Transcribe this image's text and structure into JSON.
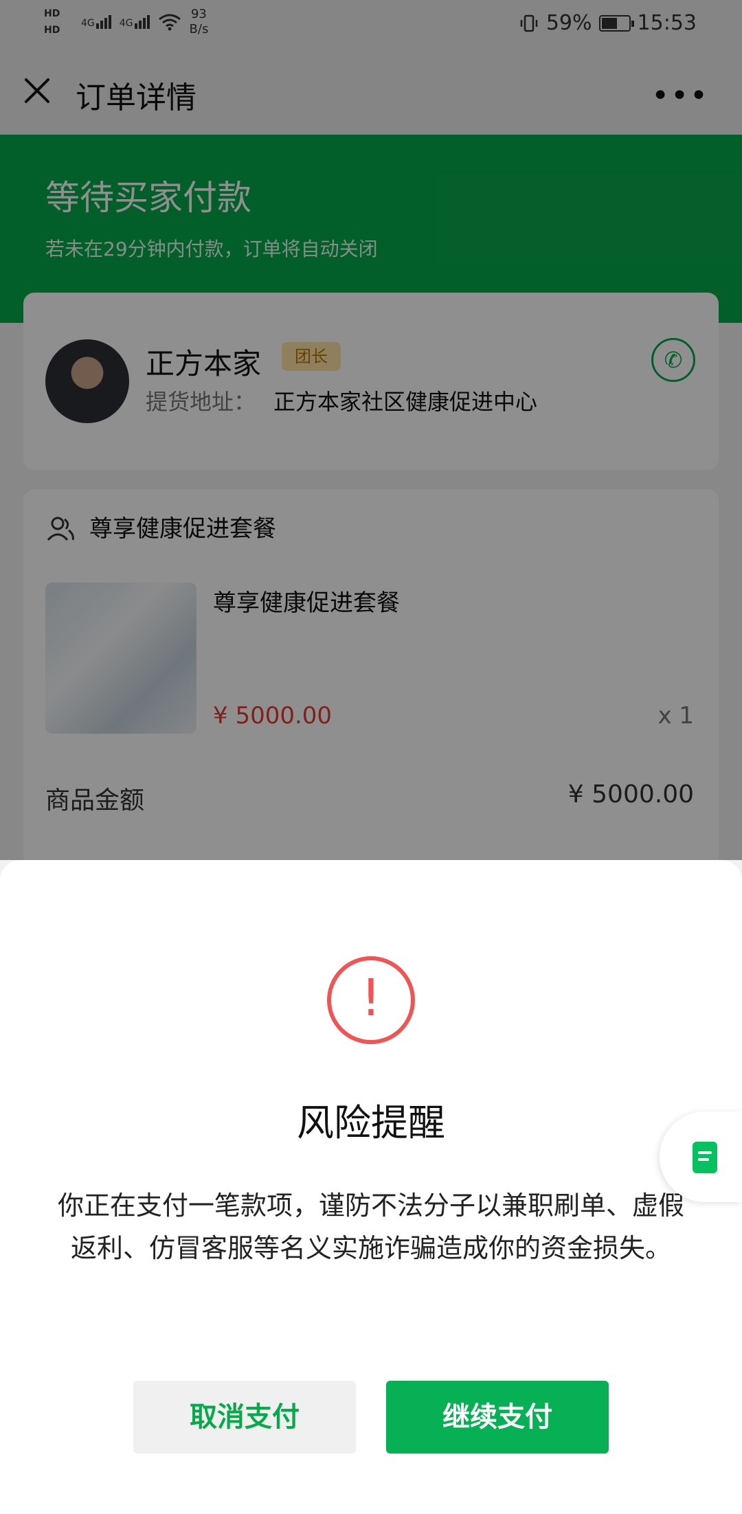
{
  "status_bar": {
    "network": "4G",
    "speed_value": "93",
    "speed_unit": "B/s",
    "battery": "59%",
    "battery_level": 0.59,
    "time": "15:53"
  },
  "header": {
    "title": "订单详情",
    "more": "•••"
  },
  "order": {
    "status_title": "等待买家付款",
    "status_sub": "若未在29分钟内付款，订单将自动关闭",
    "seller": {
      "name": "正方本家",
      "badge": "团长",
      "address_label": "提货地址：",
      "address_value": "正方本家社区健康促进中心"
    },
    "package": {
      "header": "尊享健康促进套餐",
      "product_name": "尊享健康促进套餐",
      "price": "¥ 5000.00",
      "quantity": "x 1",
      "amount_label": "商品金额",
      "amount_value": "¥ 5000.00"
    }
  },
  "risk_dialog": {
    "title": "风险提醒",
    "message": "你正在支付一笔款项，谨防不法分子以兼职刷单、虚假返利、仿冒客服等名义实施诈骗造成你的资金损失。",
    "cancel_label": "取消支付",
    "continue_label": "继续支付"
  },
  "colors": {
    "accent_green": "#07a94b",
    "warning_red": "#f05454",
    "price_red": "#e53935"
  },
  "icons": {
    "close": "close-icon",
    "more": "more-icon",
    "phone": "phone-icon",
    "user": "user-icon",
    "warning": "warning-icon",
    "document": "document-icon"
  }
}
